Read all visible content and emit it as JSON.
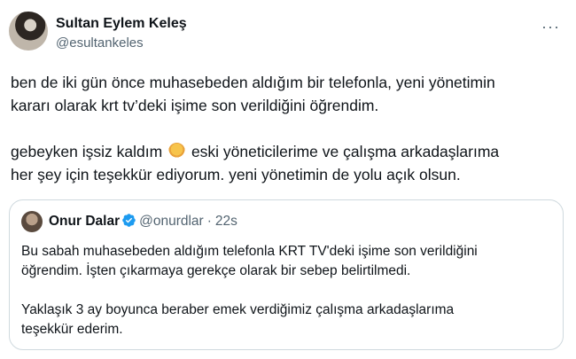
{
  "author": {
    "name": "Sultan Eylem Keleş",
    "handle": "@esultankeles"
  },
  "more_icon": "more-horizontal-icon",
  "tweet": {
    "line1": "ben de iki gün önce muhasebeden aldığım bir telefonla, yeni yönetimin",
    "line2": "kararı olarak krt tv’deki işime son verildiğini öğrendim.",
    "line3a": "gebeyken işsiz kaldım",
    "emoji": "woman-shrugging-emoji",
    "line3b": "eski yöneticilerime ve çalışma arkadaşlarıma",
    "line4": "her şey için teşekkür ediyorum. yeni yönetimin de yolu açık olsun."
  },
  "quote": {
    "name": "Onur Dalar",
    "verified_color": "#1d9bf0",
    "handle": "@onurdlar",
    "separator": "·",
    "time": "22s",
    "line1": "Bu sabah muhasebeden aldığım telefonla KRT TV'deki işime son verildiğini",
    "line2": "öğrendim. İşten çıkarmaya gerekçe olarak bir sebep belirtilmedi.",
    "line3": "Yaklaşık 3 ay boyunca beraber emek verdiğimiz çalışma arkadaşlarıma",
    "line4": "teşekkür ederim."
  }
}
